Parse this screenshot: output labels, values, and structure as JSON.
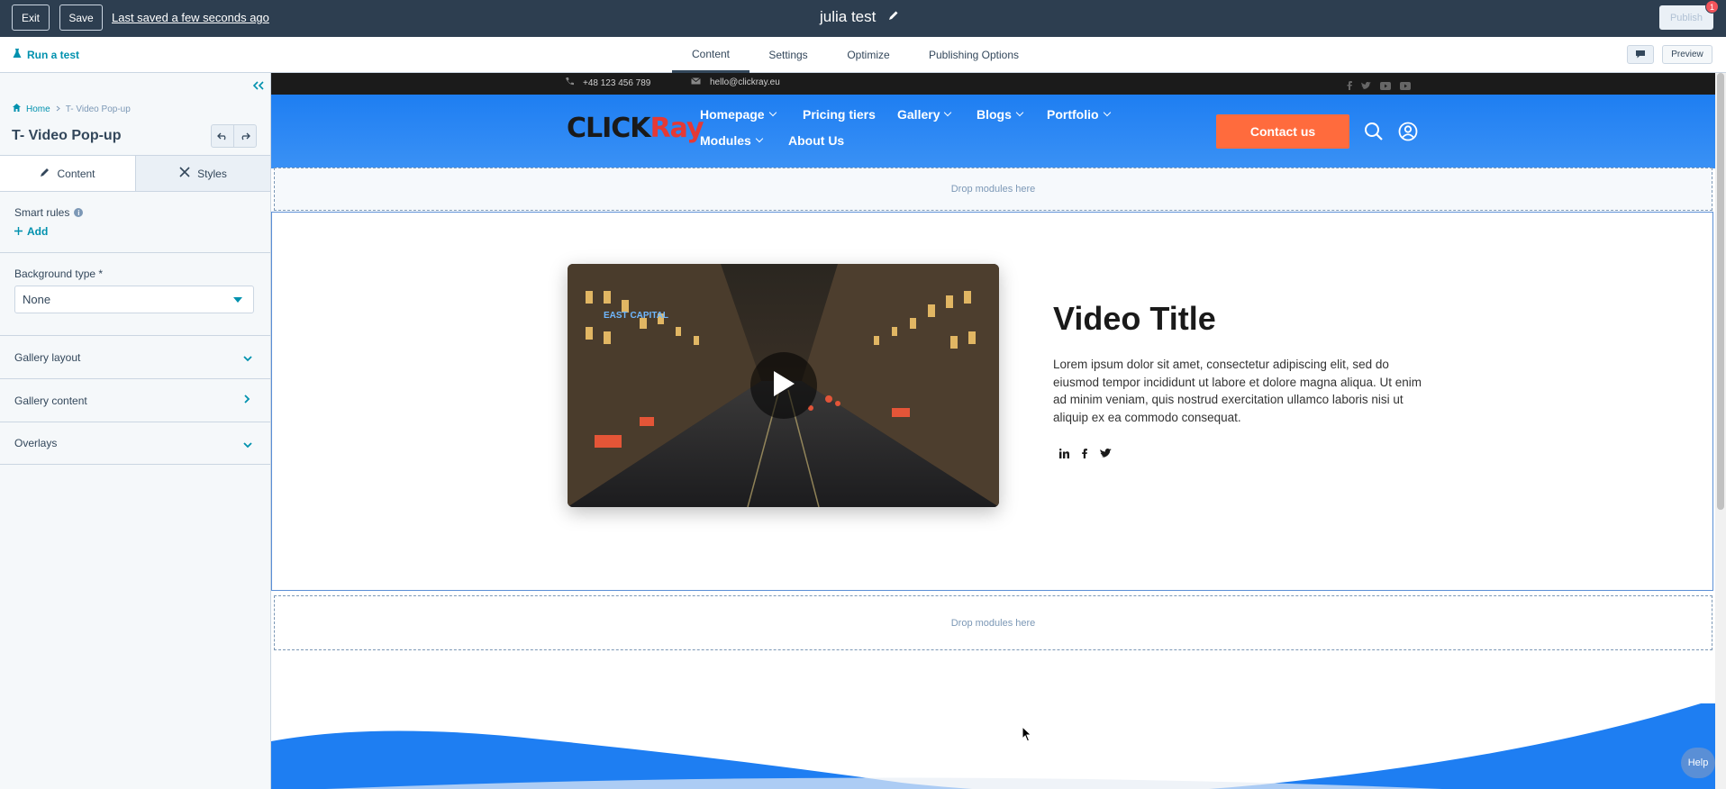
{
  "topbar": {
    "exit_label": "Exit",
    "save_label": "Save",
    "saved_status": "Last saved a few seconds ago",
    "page_name": "julia test",
    "publish_label": "Publish",
    "notification_count": "1"
  },
  "subbar": {
    "run_test_label": "Run a test",
    "tabs": [
      {
        "label": "Content",
        "active": true
      },
      {
        "label": "Settings",
        "active": false
      },
      {
        "label": "Optimize",
        "active": false
      },
      {
        "label": "Publishing Options",
        "active": false
      }
    ],
    "preview_label": "Preview"
  },
  "sidebar": {
    "breadcrumb": {
      "home": "Home",
      "current": "T- Video Pop-up"
    },
    "module_title": "T- Video Pop-up",
    "tabs": [
      {
        "label": "Content",
        "icon": "pencil-icon"
      },
      {
        "label": "Styles",
        "icon": "scissors-icon"
      }
    ],
    "smart_rules_label": "Smart rules",
    "add_label": "Add",
    "background_type_label": "Background type *",
    "background_type_value": "None",
    "sections": [
      {
        "label": "Gallery layout",
        "chevron": "down"
      },
      {
        "label": "Gallery content",
        "chevron": "right"
      },
      {
        "label": "Overlays",
        "chevron": "down"
      }
    ]
  },
  "site": {
    "phone": "+48 123 456 789",
    "email": "hello@clickray.eu",
    "logo_text_1": "CLICK",
    "logo_text_2": "Ray",
    "nav": [
      {
        "label": "Homepage",
        "dropdown": true
      },
      {
        "label": "Pricing tiers",
        "dropdown": false
      },
      {
        "label": "Gallery",
        "dropdown": true
      },
      {
        "label": "Blogs",
        "dropdown": true
      },
      {
        "label": "Portfolio",
        "dropdown": true
      },
      {
        "label": "Modules",
        "dropdown": true
      },
      {
        "label": "About Us",
        "dropdown": false
      }
    ],
    "contact_label": "Contact us",
    "drop_zone_label": "Drop modules here",
    "video_title": "Video Title",
    "video_description": "Lorem ipsum dolor sit amet, consectetur adipiscing elit, sed do eiusmod tempor incididunt ut labore et dolore magna aliqua. Ut enim ad minim veniam, quis nostrud exercitation ullamco laboris nisi ut aliquip ex ea commodo consequat.",
    "share_icons": [
      "linkedin-icon",
      "facebook-icon",
      "twitter-icon"
    ]
  },
  "help_label": "Help",
  "colors": {
    "topbar_bg": "#2d3e50",
    "accent": "#0091ae",
    "site_nav_bg": "#1e7ef2",
    "contact_btn": "#ff6b3d"
  }
}
